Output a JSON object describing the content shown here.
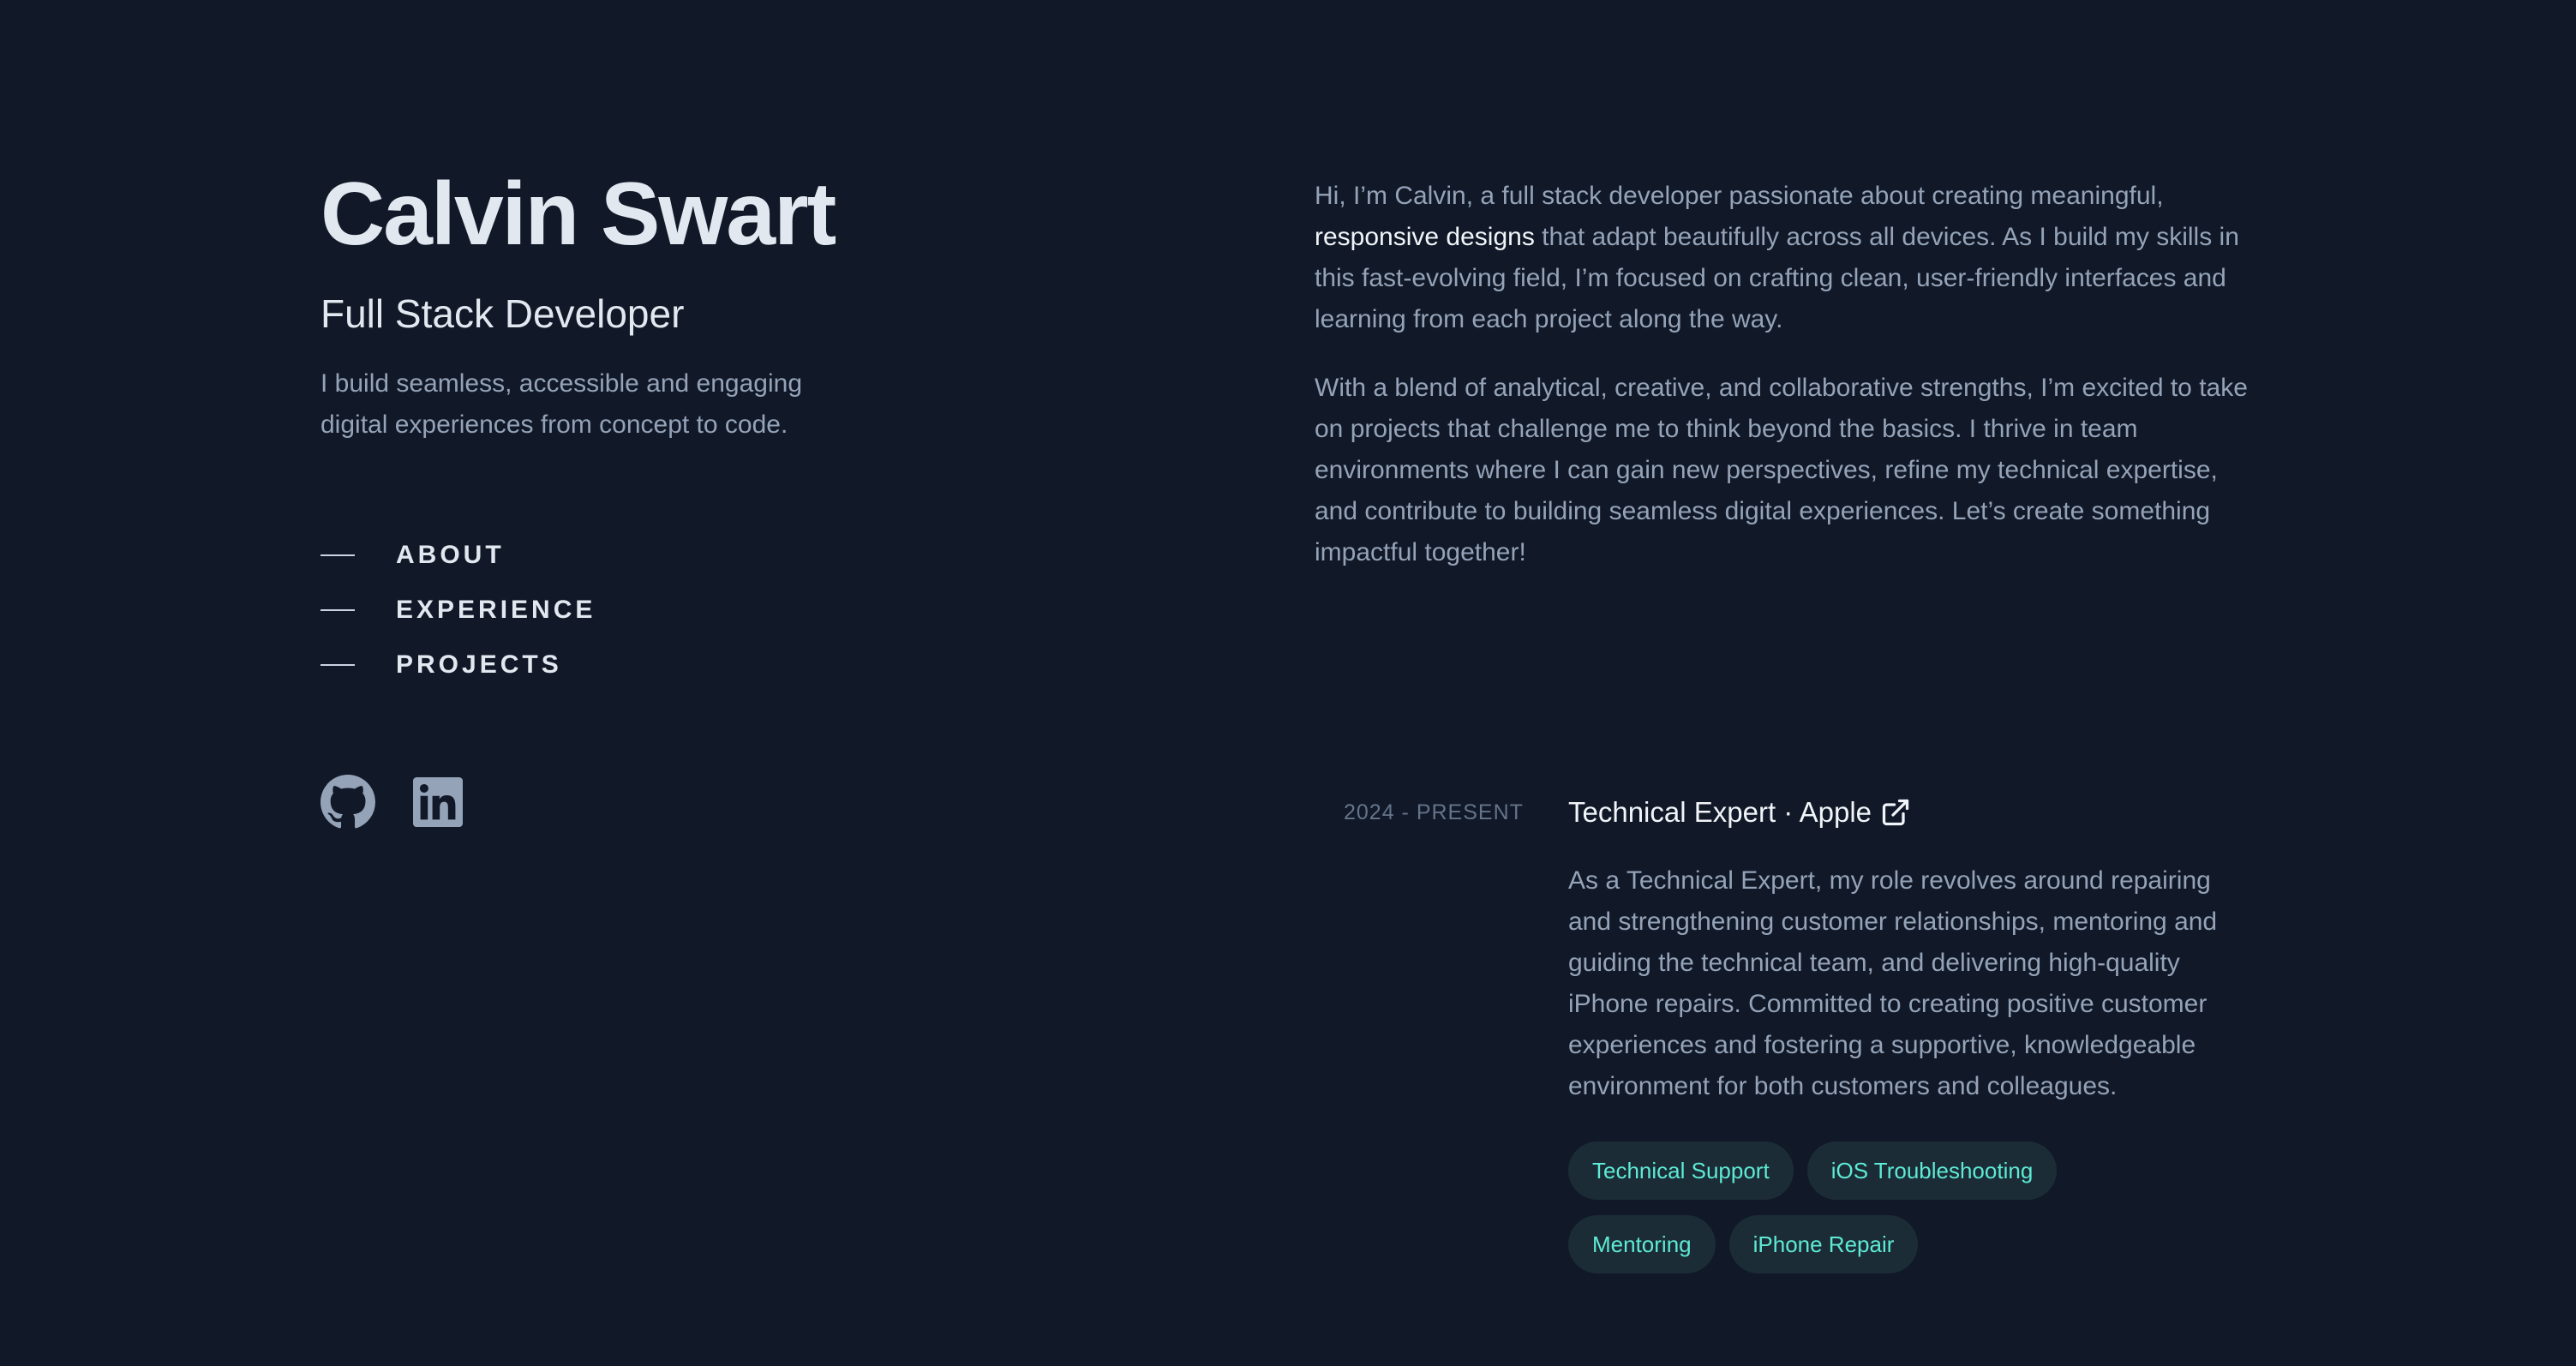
{
  "profile": {
    "name": "Calvin Swart",
    "role": "Full Stack Developer",
    "tagline": "I build seamless, accessible and engaging digital experiences from concept to code."
  },
  "nav": {
    "items": [
      {
        "label": "ABOUT"
      },
      {
        "label": "EXPERIENCE"
      },
      {
        "label": "PROJECTS"
      }
    ]
  },
  "socials": [
    "github-icon",
    "linkedin-icon"
  ],
  "about": {
    "p1_start": "Hi, I’m Calvin, a full stack developer passionate about creating meaningful, ",
    "p1_highlight": "responsive designs",
    "p1_end": " that adapt beautifully across all devices. As I build my skills in this fast-evolving field, I’m focused on crafting clean, user-friendly interfaces and learning from each project along the way.",
    "p2": "With a blend of analytical, creative, and collaborative strengths, I’m excited to take on projects that challenge me to think beyond the basics. I thrive in team environments where I can gain new perspectives, refine my technical expertise, and contribute to building seamless digital experiences. Let’s create something impactful together!"
  },
  "experience": [
    {
      "date": "2024 - PRESENT",
      "title": "Technical Expert · Apple",
      "description": "As a Technical Expert, my role revolves around repairing and strengthening customer relationships, mentoring and guiding the technical team, and delivering high-quality iPhone repairs. Committed to creating positive customer experiences and fostering a supportive, knowledgeable environment for both customers and colleagues.",
      "tags": [
        "Technical Support",
        "iOS Troubleshooting",
        "Mentoring",
        "iPhone Repair"
      ]
    }
  ],
  "colors": {
    "background": "#111827",
    "heading": "#e2e8f0",
    "text": "#94a3b8",
    "accent": "#5eead4",
    "tag_bg": "#1b2c37"
  }
}
